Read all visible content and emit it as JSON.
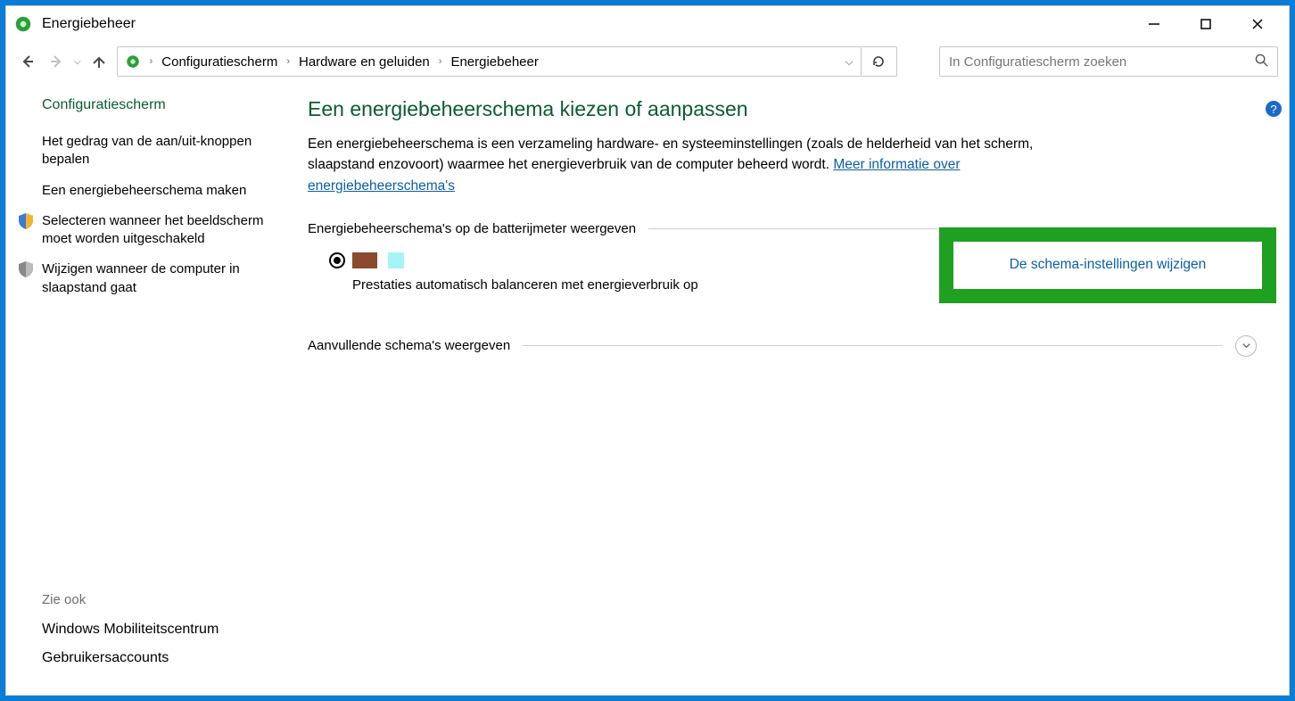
{
  "window": {
    "title": "Energiebeheer"
  },
  "breadcrumbs": {
    "items": [
      "Configuratiescherm",
      "Hardware en geluiden",
      "Energiebeheer"
    ]
  },
  "search": {
    "placeholder": "In Configuratiescherm zoeken"
  },
  "sidebar": {
    "heading": "Configuratiescherm",
    "links": [
      {
        "label": "Het gedrag van de aan/uit-knoppen bepalen"
      },
      {
        "label": "Een energiebeheerschema maken"
      },
      {
        "label": "Selecteren wanneer het beeldscherm moet worden uitgeschakeld"
      },
      {
        "label": "Wijzigen wanneer de computer in slaapstand gaat"
      }
    ],
    "see_also_heading": "Zie ook",
    "see_also": [
      {
        "label": "Windows Mobiliteitscentrum"
      },
      {
        "label": "Gebruikersaccounts"
      }
    ]
  },
  "main": {
    "heading": "Een energiebeheerschema kiezen of aanpassen",
    "description": "Een energiebeheerschema is een verzameling hardware- en systeeminstellingen (zoals de helderheid van het scherm, slaapstand enzovoort) waarmee het energieverbruik van de computer beheerd wordt. ",
    "desc_link": "Meer informatie over energiebeheerschema's",
    "section1_label": "Energiebeheerschema's op de batterijmeter weergeven",
    "plan_description": "Prestaties automatisch balanceren met energieverbruik op",
    "change_link": "De schema-instellingen wijzigen",
    "section2_label": "Aanvullende schema's weergeven"
  },
  "help_badge": "?"
}
